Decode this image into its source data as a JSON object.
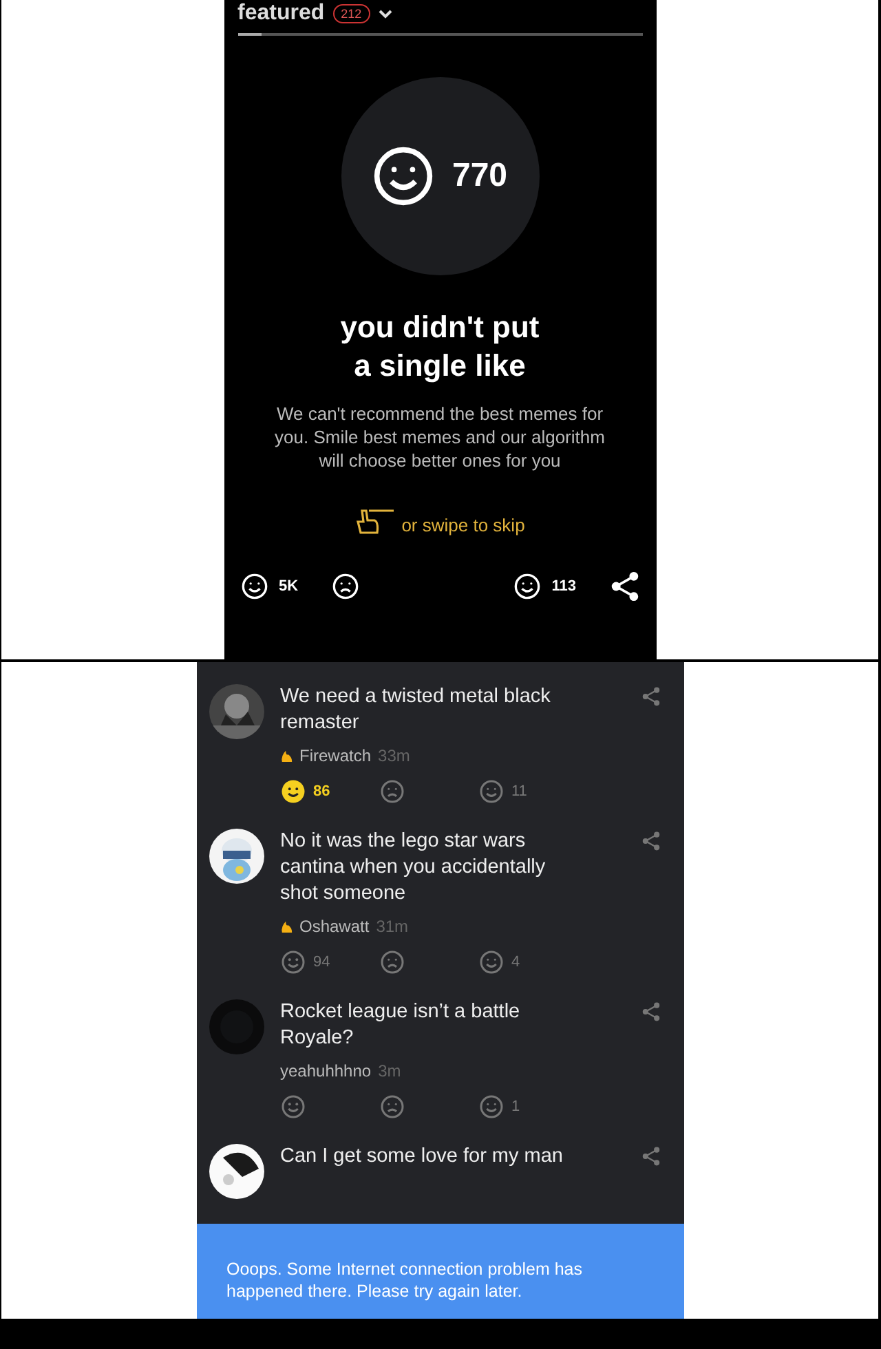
{
  "feed_screen": {
    "header": {
      "title": "featured",
      "count": "212"
    },
    "progress": {
      "level": 0.06
    },
    "likes_total": "770",
    "heading_line_1": "you didn't put",
    "heading_line_2": "a single like",
    "description": "We can't recommend the best memes for you. Smile best memes and our algorithm will choose better ones for you",
    "swipe_hint": "or swipe to skip",
    "actions": {
      "smiles": "5K",
      "comments": "113"
    }
  },
  "comments_screen": {
    "comments": [
      {
        "text": "We need a twisted metal black remaster",
        "author": "Firewatch",
        "time": "33m",
        "featured_author": true,
        "smiles": "86",
        "liked": true,
        "replies": "11"
      },
      {
        "text": "No it was the lego star wars cantina when you accidentally shot someone",
        "author": "Oshawatt",
        "time": "31m",
        "featured_author": true,
        "smiles": "94",
        "liked": false,
        "replies": "4"
      },
      {
        "text": "Rocket league isn’t a battle Royale?",
        "author": "yeahuhhhno",
        "time": "3m",
        "featured_author": false,
        "liked": false,
        "replies": "1"
      },
      {
        "text": "Can I get some love for my man"
      }
    ],
    "toast": "Ooops. Some Internet connection problem has happened there. Please try again later."
  }
}
